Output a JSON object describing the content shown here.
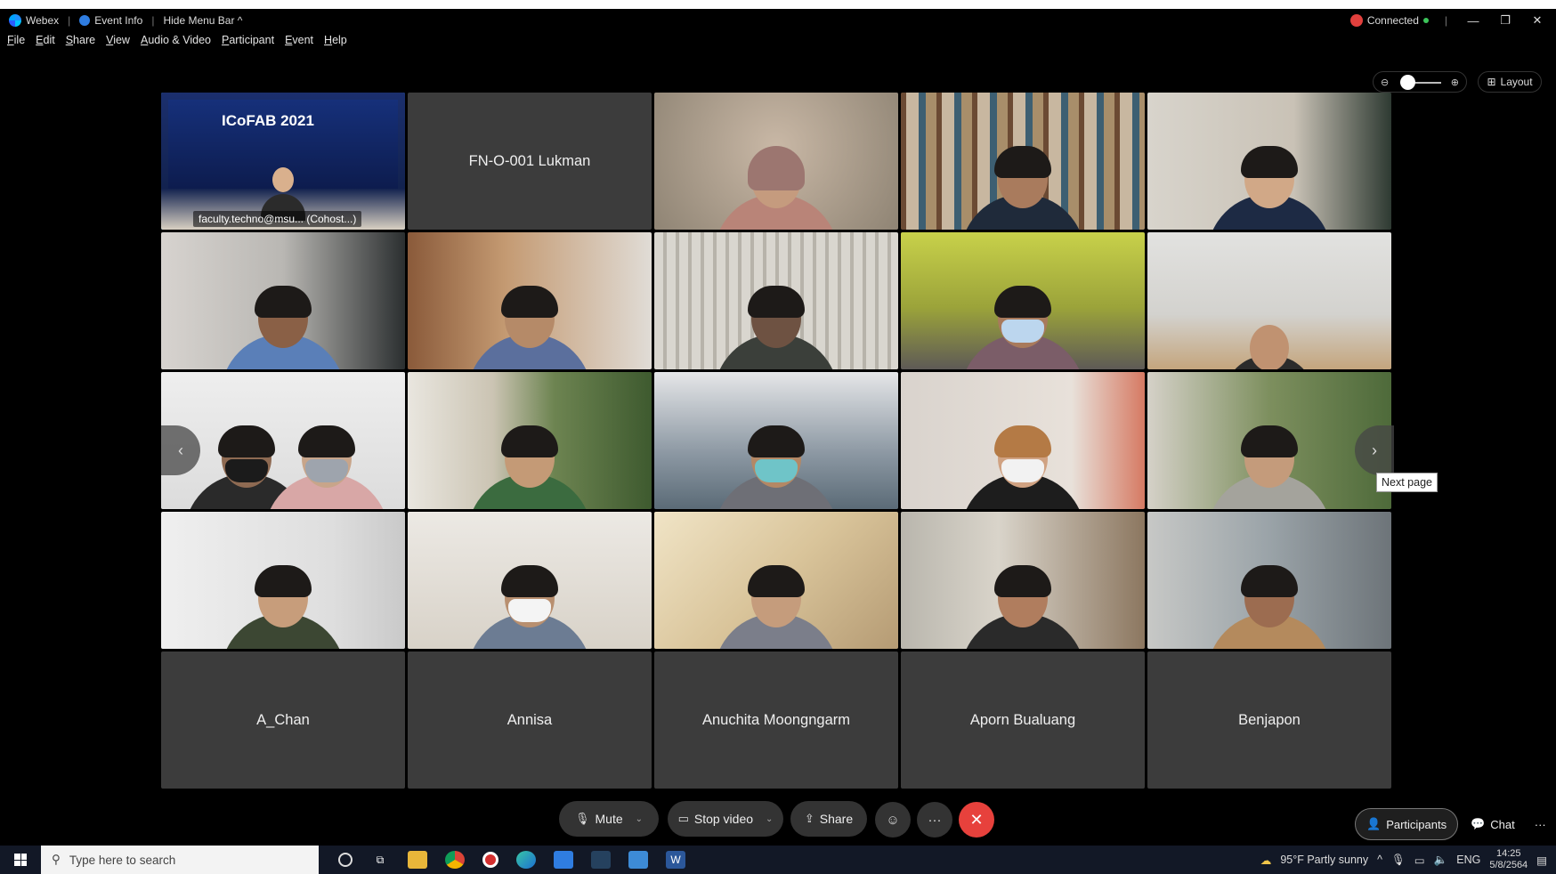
{
  "titlebar": {
    "app_name": "Webex",
    "event_info": "Event Info",
    "hide_menu_bar": "Hide Menu Bar ^",
    "status": "Connected"
  },
  "menu": [
    "File",
    "Edit",
    "Share",
    "View",
    "Audio & Video",
    "Participant",
    "Event",
    "Help"
  ],
  "layout_label": "Layout",
  "tiles": [
    {
      "label": "faculty.techno@msu... (Cohost...)",
      "kind": "stage",
      "banner": "ICoFAB 2021"
    },
    {
      "label": "FN-O-001 Lukman",
      "kind": "name"
    },
    {
      "kind": "video"
    },
    {
      "kind": "video"
    },
    {
      "kind": "video"
    },
    {
      "kind": "video"
    },
    {
      "kind": "video"
    },
    {
      "kind": "video"
    },
    {
      "kind": "video"
    },
    {
      "kind": "video"
    },
    {
      "kind": "video"
    },
    {
      "kind": "video"
    },
    {
      "kind": "video"
    },
    {
      "kind": "video"
    },
    {
      "kind": "video"
    },
    {
      "kind": "video"
    },
    {
      "kind": "video"
    },
    {
      "kind": "video"
    },
    {
      "kind": "video"
    },
    {
      "kind": "video"
    },
    {
      "label": "A_Chan",
      "kind": "name"
    },
    {
      "label": "Annisa",
      "kind": "name"
    },
    {
      "label": "Anuchita Moongngarm",
      "kind": "name"
    },
    {
      "label": "Aporn Bualuang",
      "kind": "name"
    },
    {
      "label": "Benjapon",
      "kind": "name"
    }
  ],
  "next_page_tooltip": "Next page",
  "controls": {
    "mute": "Mute",
    "stop_video": "Stop video",
    "share": "Share",
    "participants": "Participants",
    "chat": "Chat"
  },
  "taskbar": {
    "search_placeholder": "Type here to search",
    "weather": "95°F  Partly sunny",
    "lang": "ENG",
    "time": "14:25",
    "date": "5/8/2564"
  },
  "colors": {
    "active_border": "#1ea7ff",
    "end_call": "#e7413c",
    "recording": "#e2403d"
  }
}
